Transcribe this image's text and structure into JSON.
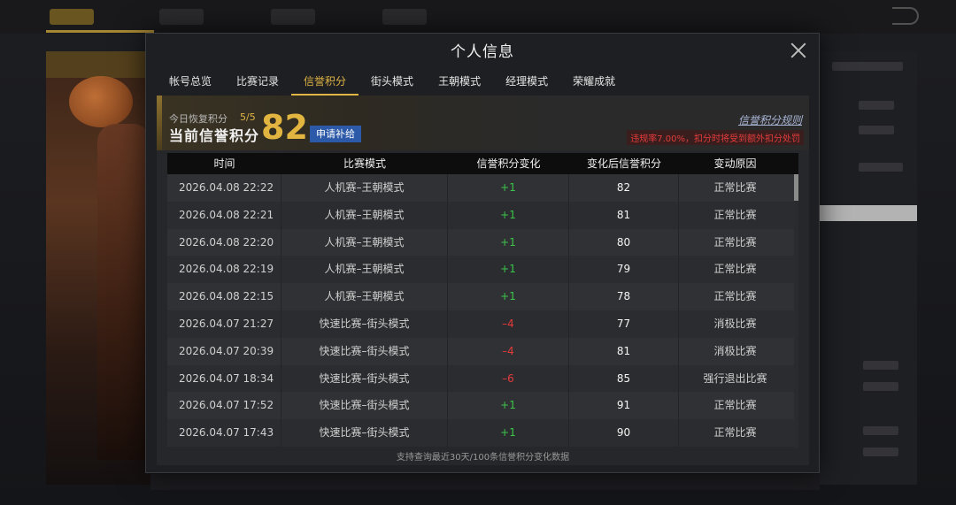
{
  "modal": {
    "title": "个人信息",
    "tabs": [
      {
        "label": "帐号总览",
        "active": false
      },
      {
        "label": "比赛记录",
        "active": false
      },
      {
        "label": "信誉积分",
        "active": true
      },
      {
        "label": "街头模式",
        "active": false
      },
      {
        "label": "王朝模式",
        "active": false
      },
      {
        "label": "经理模式",
        "active": false
      },
      {
        "label": "荣耀成就",
        "active": false
      }
    ]
  },
  "banner": {
    "restore_label": "今日恢复积分",
    "restore_count": "5/5",
    "current_label": "当前信誉积分",
    "score": "82",
    "apply_button": "申请补给",
    "rules_link": "信誉积分规则",
    "warning": "违规率7.00%，扣分时将受到额外扣分处罚"
  },
  "table": {
    "headers": [
      "时间",
      "比赛模式",
      "信誉积分变化",
      "变化后信誉积分",
      "变动原因"
    ],
    "rows": [
      {
        "time": "2026.04.08  22:22",
        "mode": "人机赛–王朝模式",
        "change": "+1",
        "after": "82",
        "reason": "正常比赛"
      },
      {
        "time": "2026.04.08  22:21",
        "mode": "人机赛–王朝模式",
        "change": "+1",
        "after": "81",
        "reason": "正常比赛"
      },
      {
        "time": "2026.04.08  22:20",
        "mode": "人机赛–王朝模式",
        "change": "+1",
        "after": "80",
        "reason": "正常比赛"
      },
      {
        "time": "2026.04.08  22:19",
        "mode": "人机赛–王朝模式",
        "change": "+1",
        "after": "79",
        "reason": "正常比赛"
      },
      {
        "time": "2026.04.08  22:15",
        "mode": "人机赛–王朝模式",
        "change": "+1",
        "after": "78",
        "reason": "正常比赛"
      },
      {
        "time": "2026.04.07  21:27",
        "mode": "快速比赛–街头模式",
        "change": "–4",
        "after": "77",
        "reason": "消极比赛"
      },
      {
        "time": "2026.04.07  20:39",
        "mode": "快速比赛–街头模式",
        "change": "–4",
        "after": "81",
        "reason": "消极比赛"
      },
      {
        "time": "2026.04.07  18:34",
        "mode": "快速比赛–街头模式",
        "change": "–6",
        "after": "85",
        "reason": "强行退出比赛"
      },
      {
        "time": "2026.04.07  17:52",
        "mode": "快速比赛–街头模式",
        "change": "+1",
        "after": "91",
        "reason": "正常比赛"
      },
      {
        "time": "2026.04.07  17:43",
        "mode": "快速比赛–街头模式",
        "change": "+1",
        "after": "90",
        "reason": "正常比赛"
      }
    ],
    "footer_note": "支持查询最近30天/100条信誉积分变化数据"
  },
  "colors": {
    "accent_gold": "#e0b445",
    "positive": "#3cc44a",
    "negative": "#e33a3a",
    "button_blue": "#2d5aa8"
  },
  "icons": {
    "close": "close-icon",
    "back": "back-arrow-icon"
  }
}
